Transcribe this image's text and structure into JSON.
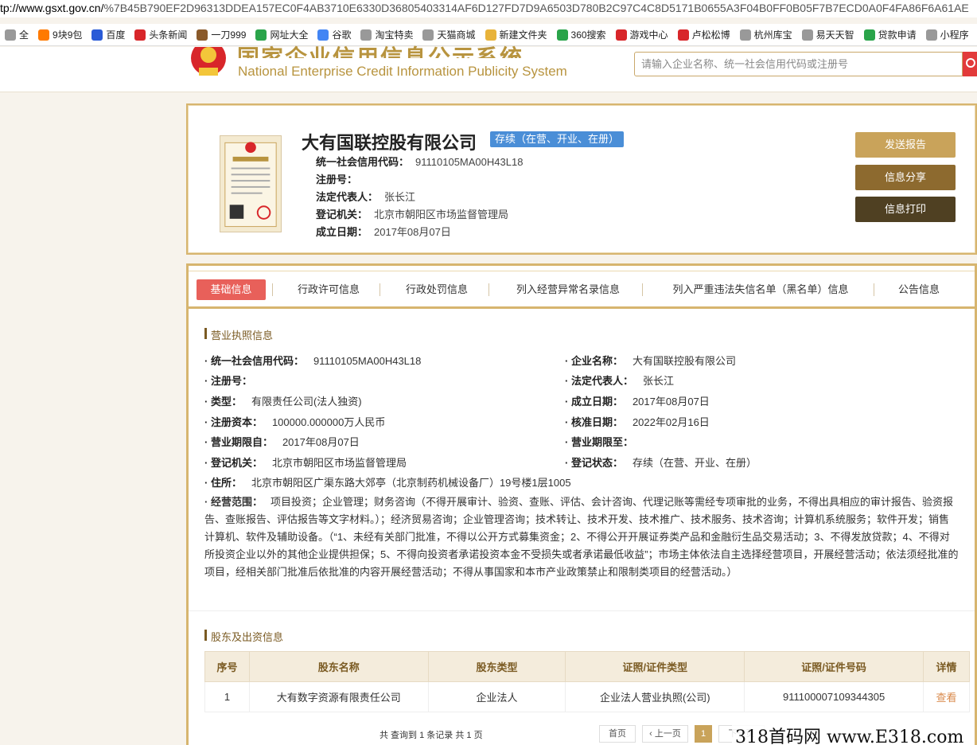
{
  "browser": {
    "url_prefix": "tp://www.gsxt.gov.cn/",
    "url_path": "%7B45B790EF2D96313DDEA157EC0F4AB3710E6330D36805403314AF6D127FD7D9A6503D780B2C97C4C8D5171B0655A3F04B0FF0B05F7B7ECD0A0F4FA86F6A61AE",
    "bookmarks": [
      {
        "label": "全",
        "icon": "globe-icon",
        "color": "#999"
      },
      {
        "label": "9块9包",
        "icon": "taobao-icon",
        "color": "#ff7a00"
      },
      {
        "label": "百度",
        "icon": "baidu-icon",
        "color": "#2a5bd7"
      },
      {
        "label": "头条新闻",
        "icon": "toutiao-icon",
        "color": "#d8262a"
      },
      {
        "label": "一刀999",
        "icon": "game-icon",
        "color": "#8a5a2b"
      },
      {
        "label": "网址大全",
        "icon": "shield-icon",
        "color": "#2aa44a"
      },
      {
        "label": "谷歌",
        "icon": "google-icon",
        "color": "#4285f4"
      },
      {
        "label": "淘宝特卖",
        "icon": "globe-icon",
        "color": "#999"
      },
      {
        "label": "天猫商城",
        "icon": "globe-icon",
        "color": "#999"
      },
      {
        "label": "新建文件夹",
        "icon": "folder-icon",
        "color": "#e8b33a"
      },
      {
        "label": "360搜索",
        "icon": "search-icon",
        "color": "#2aa44a"
      },
      {
        "label": "游戏中心",
        "icon": "game-icon",
        "color": "#d8262a"
      },
      {
        "label": "卢松松博",
        "icon": "blog-icon",
        "color": "#d8262a"
      },
      {
        "label": "杭州库宝",
        "icon": "globe-icon",
        "color": "#999"
      },
      {
        "label": "易天天智",
        "icon": "globe-icon",
        "color": "#999"
      },
      {
        "label": "贷款申请",
        "icon": "chat-icon",
        "color": "#2aa44a"
      },
      {
        "label": "小程序",
        "icon": "globe-icon",
        "color": "#999"
      }
    ]
  },
  "header": {
    "title_cn": "国家企业信用信息公示系统",
    "title_en": "National Enterprise Credit Information Publicity System",
    "search_placeholder": "请输入企业名称、统一社会信用代码或注册号"
  },
  "company": {
    "name": "大有国联控股有限公司",
    "status": "存续（在营、开业、在册）",
    "rows": [
      {
        "k": "统一社会信用代码：",
        "v": "91110105MA00H43L18"
      },
      {
        "k": "注册号：",
        "v": ""
      },
      {
        "k": "法定代表人：",
        "v": "张长江"
      },
      {
        "k": "登记机关：",
        "v": "北京市朝阳区市场监督管理局"
      },
      {
        "k": "成立日期：",
        "v": "2017年08月07日"
      }
    ],
    "buttons": {
      "send": "发送报告",
      "share": "信息分享",
      "print": "信息打印"
    }
  },
  "tabs": [
    "基础信息",
    "行政许可信息",
    "行政处罚信息",
    "列入经营异常名录信息",
    "列入严重违法失信名单（黑名单）信息",
    "公告信息"
  ],
  "license_section": {
    "title": "营业执照信息",
    "left": [
      {
        "k": "· 统一社会信用代码：",
        "v": "91110105MA00H43L18"
      },
      {
        "k": "· 注册号：",
        "v": ""
      },
      {
        "k": "· 类型：",
        "v": "有限责任公司(法人独资)"
      },
      {
        "k": "· 注册资本：",
        "v": "100000.000000万人民币"
      },
      {
        "k": "· 营业期限自：",
        "v": "2017年08月07日"
      },
      {
        "k": "· 登记机关：",
        "v": "北京市朝阳区市场监督管理局"
      }
    ],
    "right": [
      {
        "k": "· 企业名称：",
        "v": "大有国联控股有限公司"
      },
      {
        "k": "· 法定代表人：",
        "v": "张长江"
      },
      {
        "k": "· 成立日期：",
        "v": "2017年08月07日"
      },
      {
        "k": "· 核准日期：",
        "v": "2022年02月16日"
      },
      {
        "k": "· 营业期限至：",
        "v": ""
      },
      {
        "k": "· 登记状态：",
        "v": "存续（在营、开业、在册）"
      }
    ],
    "address_k": "· 住所：",
    "address_v": "北京市朝阳区广渠东路大郊亭（北京制药机械设备厂）19号楼1层1005",
    "scope_k": "· 经营范围：",
    "scope_v": "项目投资；企业管理；财务咨询（不得开展审计、验资、查账、评估、会计咨询、代理记账等需经专项审批的业务，不得出具相应的审计报告、验资报告、查账报告、评估报告等文字材料。）；经济贸易咨询；企业管理咨询；技术转让、技术开发、技术推广、技术服务、技术咨询；计算机系统服务；软件开发；销售计算机、软件及辅助设备。（“1、未经有关部门批准，不得以公开方式募集资金；2、不得公开开展证券类产品和金融衍生品交易活动；3、不得发放贷款；4、不得对所投资企业以外的其他企业提供担保；5、不得向投资者承诺投资本金不受损失或者承诺最低收益”；市场主体依法自主选择经营项目，开展经营活动；依法须经批准的项目，经相关部门批准后依批准的内容开展经营活动；不得从事国家和本市产业政策禁止和限制类项目的经营活动。）"
  },
  "shareholders": {
    "title": "股东及出资信息",
    "headers": [
      "序号",
      "股东名称",
      "股东类型",
      "证照/证件类型",
      "证照/证件号码",
      "详情"
    ],
    "rows": [
      {
        "no": "1",
        "name": "大有数字资源有限责任公司",
        "type": "企业法人",
        "cert_type": "企业法人营业执照(公司)",
        "cert_no": "911100007109344305",
        "detail": "查看"
      }
    ],
    "pager_text": "共 查询到 1 条记录 共 1 页",
    "pager": {
      "first": "首页",
      "prev": "‹ 上一页",
      "current": "1",
      "next": "下一页"
    }
  },
  "watermark": "318首码网 www.E318.com"
}
